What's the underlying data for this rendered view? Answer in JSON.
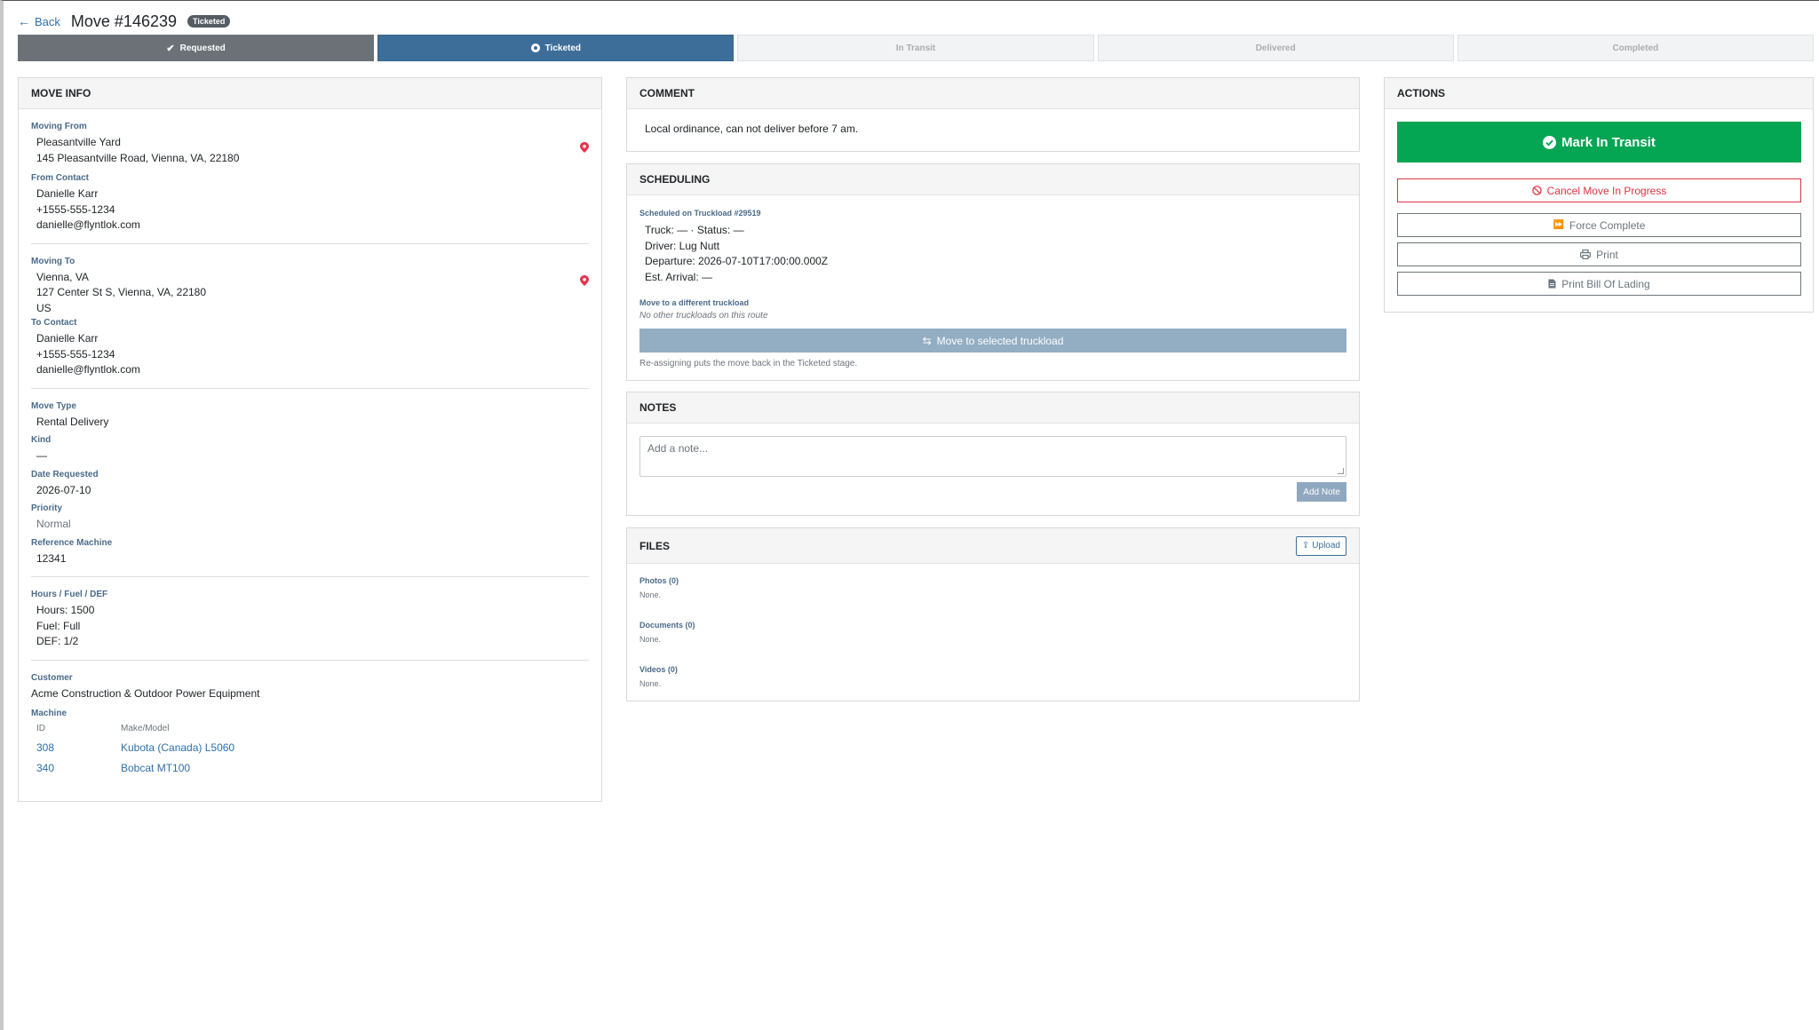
{
  "header": {
    "back_label": "Back",
    "title": "Move #146239",
    "status_badge": "Ticketed"
  },
  "stepper": {
    "steps": [
      {
        "label": "Requested",
        "state": "done"
      },
      {
        "label": "Ticketed",
        "state": "active"
      },
      {
        "label": "In Transit",
        "state": "pending"
      },
      {
        "label": "Delivered",
        "state": "pending"
      },
      {
        "label": "Completed",
        "state": "pending"
      }
    ]
  },
  "move_info": {
    "title": "MOVE INFO",
    "moving_from": {
      "label": "Moving From",
      "name": "Pleasantville Yard",
      "address": "145 Pleasantville Road, Vienna, VA, 22180"
    },
    "from_contact": {
      "label": "From Contact",
      "name": "Danielle Karr",
      "phone": "+1555-555-1234",
      "email": "danielle@flyntlok.com"
    },
    "moving_to": {
      "label": "Moving To",
      "name": "Vienna, VA",
      "address": "127 Center St S, Vienna, VA, 22180",
      "country": "US"
    },
    "to_contact": {
      "label": "To Contact",
      "name": "Danielle Karr",
      "phone": "+1555-555-1234",
      "email": "danielle@flyntlok.com"
    },
    "move_type": {
      "label": "Move Type",
      "value": "Rental Delivery"
    },
    "kind": {
      "label": "Kind",
      "value": "—"
    },
    "date_requested": {
      "label": "Date Requested",
      "value": "2026-07-10"
    },
    "priority": {
      "label": "Priority",
      "value": "Normal"
    },
    "reference_machine": {
      "label": "Reference Machine",
      "value": "12341"
    },
    "hours_fuel_def": {
      "label": "Hours / Fuel / DEF",
      "hours": "Hours: 1500",
      "fuel": "Fuel: Full",
      "def": "DEF: 1/2"
    },
    "customer": {
      "label": "Customer",
      "value": "Acme Construction & Outdoor Power Equipment"
    },
    "machine": {
      "label": "Machine",
      "columns": [
        "ID",
        "Make/Model"
      ],
      "rows": [
        {
          "id": "308",
          "make_model": "Kubota (Canada) L5060"
        },
        {
          "id": "340",
          "make_model": "Bobcat MT100"
        }
      ]
    }
  },
  "comment": {
    "title": "COMMENT",
    "text": "Local ordinance, can not deliver before 7 am."
  },
  "scheduling": {
    "title": "SCHEDULING",
    "scheduled_label": "Scheduled on Truckload #29519",
    "truck": "Truck: — · Status: —",
    "driver": "Driver: Lug Nutt",
    "departure": "Departure: 2026-07-10T17:00:00.000Z",
    "arrival": "Est. Arrival: —",
    "move_label": "Move to a different truckload",
    "no_truckloads": "No other truckloads on this route",
    "move_button": "Move to selected truckload",
    "help": "Re-assigning puts the move back in the Ticketed stage."
  },
  "notes": {
    "title": "NOTES",
    "placeholder": "Add a note...",
    "add_button": "Add Note"
  },
  "files": {
    "title": "FILES",
    "upload_button": "Upload",
    "photos_label": "Photos (0)",
    "photos_value": "None.",
    "documents_label": "Documents (0)",
    "documents_value": "None.",
    "videos_label": "Videos (0)",
    "videos_value": "None."
  },
  "actions": {
    "title": "ACTIONS",
    "mark_in_transit": "Mark In Transit",
    "cancel": "Cancel Move In Progress",
    "force_complete": "Force Complete",
    "print": "Print",
    "print_bol": "Print Bill Of Lading"
  },
  "colors": {
    "accent": "#3d6e99",
    "success": "#04a553",
    "danger": "#dc3545",
    "pin": "#e8334a"
  }
}
